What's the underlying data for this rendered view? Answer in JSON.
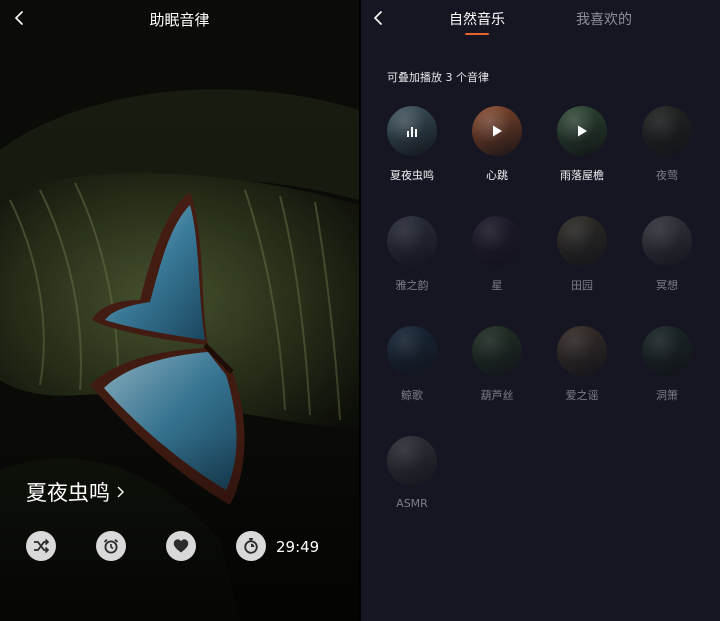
{
  "player": {
    "title": "助眠音律",
    "track_name": "夏夜虫鸣",
    "timer": "29:49",
    "controls": [
      "shuffle-icon",
      "alarm-clock-icon",
      "heart-icon",
      "timer-icon"
    ]
  },
  "library": {
    "tabs": [
      {
        "label": "自然音乐",
        "active": true
      },
      {
        "label": "我喜欢的",
        "active": false
      }
    ],
    "hint": "可叠加播放 3 个音律",
    "accent_color": "#e8622c",
    "items": [
      {
        "label": "夏夜虫鸣",
        "state": "playing",
        "color": "#3e5560"
      },
      {
        "label": "心跳",
        "state": "selected",
        "color": "#8a4a2e"
      },
      {
        "label": "雨落屋檐",
        "state": "selected",
        "color": "#2f4a35"
      },
      {
        "label": "夜莺",
        "state": "off",
        "color": "#2c3524"
      },
      {
        "label": "雅之韵",
        "state": "off",
        "color": "#404655"
      },
      {
        "label": "星",
        "state": "off",
        "color": "#2b2238"
      },
      {
        "label": "田园",
        "state": "off",
        "color": "#4b4530"
      },
      {
        "label": "冥想",
        "state": "off",
        "color": "#55585c"
      },
      {
        "label": "鲸歌",
        "state": "off",
        "color": "#1d3a52"
      },
      {
        "label": "葫芦丝",
        "state": "off",
        "color": "#2e4a2a"
      },
      {
        "label": "爱之谣",
        "state": "off",
        "color": "#5a4632"
      },
      {
        "label": "洞箫",
        "state": "off",
        "color": "#22382d"
      },
      {
        "label": "ASMR",
        "state": "off",
        "color": "#4a4c50"
      }
    ]
  }
}
